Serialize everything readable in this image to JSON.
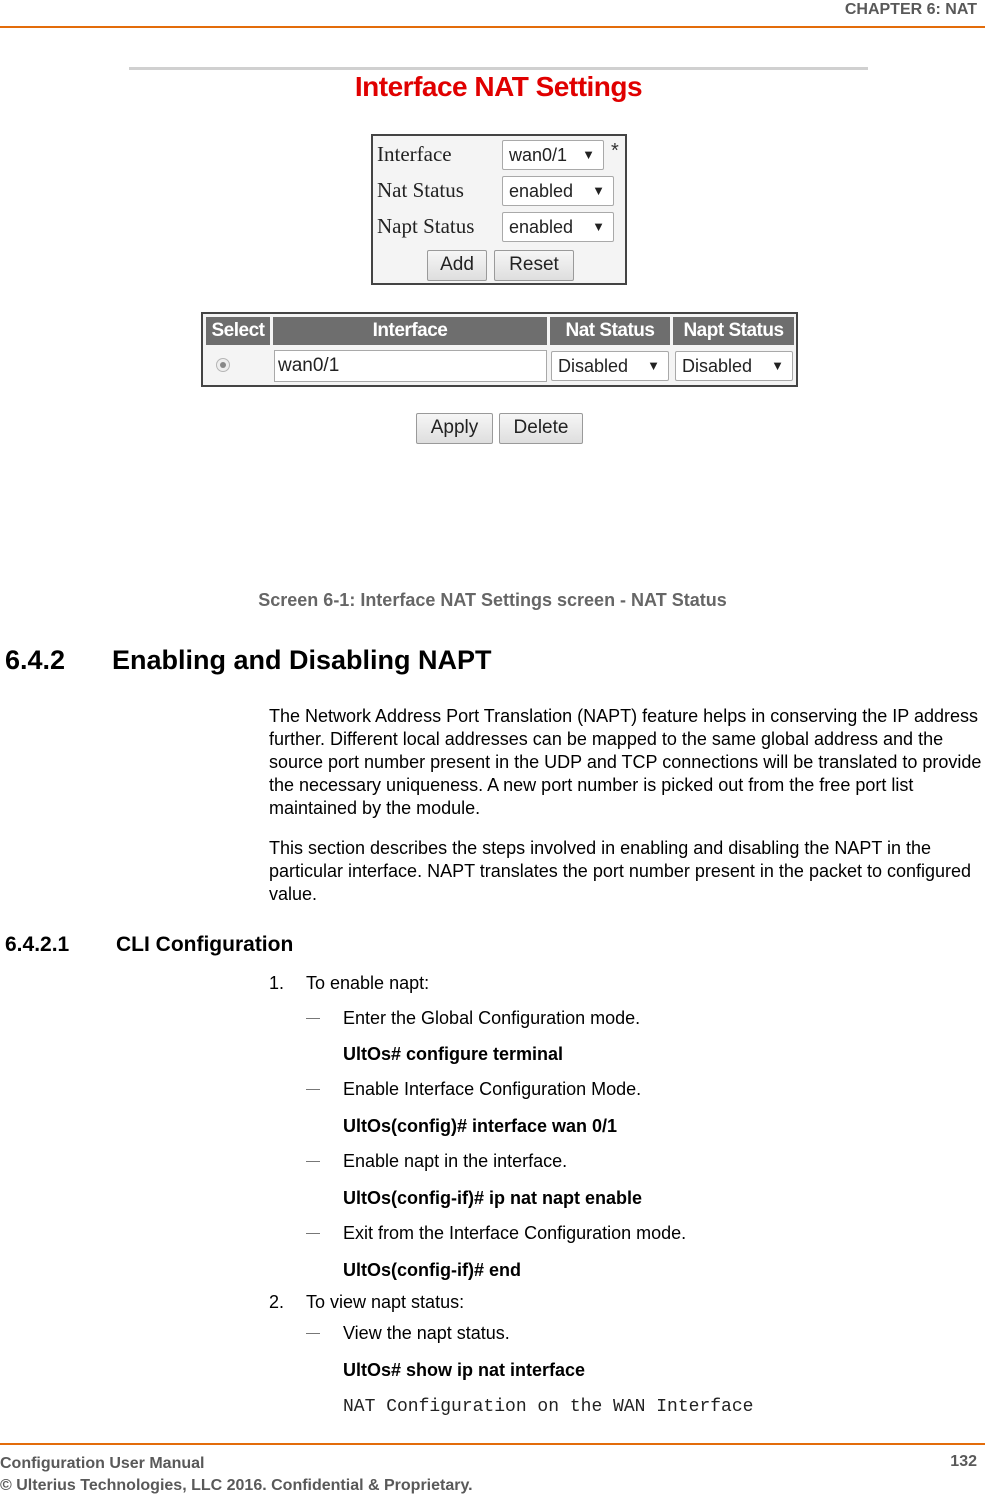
{
  "header": {
    "chapter": "CHAPTER 6: NAT"
  },
  "screenshot": {
    "title": "Interface NAT Settings",
    "form": {
      "interface_label": "Interface",
      "interface_value": "wan0/1",
      "required_mark": "*",
      "nat_status_label": "Nat Status",
      "nat_status_value": "enabled",
      "napt_status_label": "Napt Status",
      "napt_status_value": "enabled",
      "add_label": "Add",
      "reset_label": "Reset",
      "arrow": "▼"
    },
    "table": {
      "columns": [
        "Select",
        "Interface",
        "Nat Status",
        "Napt Status"
      ],
      "rows": [
        {
          "selected": true,
          "interface": "wan0/1",
          "nat_status": "Disabled",
          "napt_status": "Disabled"
        }
      ]
    },
    "apply_label": "Apply",
    "delete_label": "Delete"
  },
  "caption": "Screen 6-1: Interface NAT Settings screen - NAT Status",
  "section": {
    "number": "6.4.2",
    "title": "Enabling and Disabling NAPT",
    "paragraphs": [
      "The Network Address Port Translation (NAPT) feature helps in conserving the IP address further. Different local addresses can be mapped to the same global address and the source port number present in the UDP and TCP connections will be translated to provide the necessary uniqueness. A new port number is picked out from the free port list maintained by the module.",
      "This section describes the steps involved in enabling and disabling the NAPT in the particular interface. NAPT translates the port number present in the packet to configured value."
    ]
  },
  "subsection": {
    "number": "6.4.2.1",
    "title": "CLI Configuration",
    "items": [
      {
        "num": "1.",
        "text": "To enable napt:",
        "steps": [
          {
            "text": "Enter the Global Configuration mode.",
            "command": "UltOs# configure terminal"
          },
          {
            "text": "Enable Interface Configuration Mode.",
            "command": "UltOs(config)# interface wan 0/1"
          },
          {
            "text": "Enable napt in the interface.",
            "command": "UltOs(config-if)# ip nat napt enable"
          },
          {
            "text": "Exit from the Interface Configuration mode.",
            "command": "UltOs(config-if)# end"
          }
        ]
      },
      {
        "num": "2.",
        "text": "To view napt status:",
        "steps": [
          {
            "text": "View the napt status.",
            "command": "UltOs# show ip nat interface",
            "output": "NAT Configuration on the WAN Interface"
          }
        ]
      }
    ]
  },
  "footer": {
    "manual": "Configuration User Manual",
    "copyright": "© Ulterius Technologies, LLC 2016. Confidential & Proprietary.",
    "page": "132"
  }
}
